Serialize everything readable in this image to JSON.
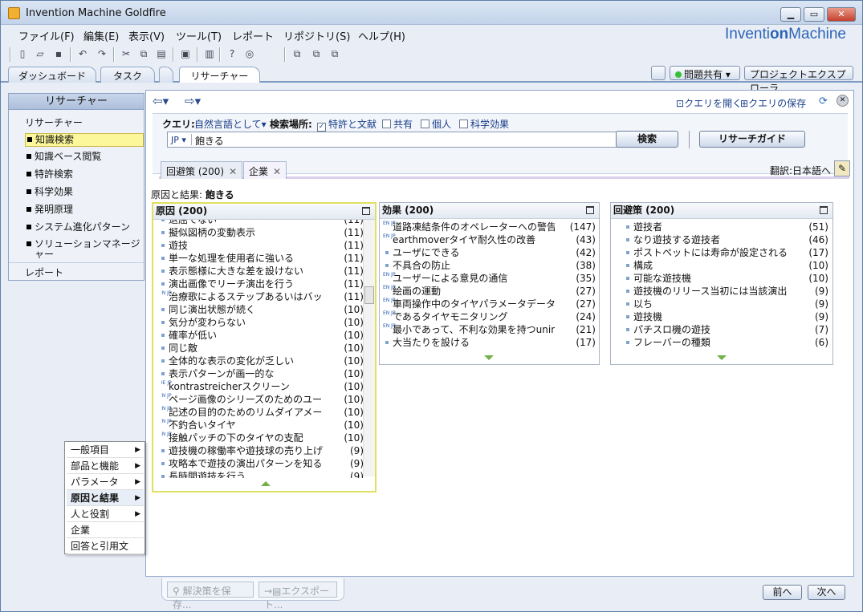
{
  "window": {
    "title": "Invention Machine Goldfire"
  },
  "brand": {
    "part1": "Inventi",
    "part2": "on",
    "part3": "Machine"
  },
  "menu": [
    "ファイル(F)",
    "編集(E)",
    "表示(V)",
    "ツール(T)",
    "レポート",
    "リポジトリ(S)",
    "ヘルプ(H)"
  ],
  "tabs": [
    "ダッシュボード",
    "タスク",
    "リサーチャー"
  ],
  "right_buttons": {
    "issue": "問題共有 ▾",
    "explorer": "プロジェクトエクスプローラ"
  },
  "sidebar": {
    "header": "リサーチャー",
    "section": "リサーチャー",
    "items": [
      "知識検索",
      "知識ベース閲覧",
      "特許検索",
      "科学効果",
      "発明原理",
      "システム進化パターン",
      "ソリューションマネージャー"
    ],
    "footer": "レポート"
  },
  "nav": {
    "open_query": "クエリを開く",
    "save_query": "クエリの保存"
  },
  "query": {
    "label": "クエリ:",
    "mode": "自然言語として",
    "location_label": "検索場所:",
    "opt_patent": "特許と文献",
    "opt_shared": "共有",
    "opt_personal": "個人",
    "opt_science": "科学効果",
    "lang": "JP ▾",
    "value": "飽きる",
    "search_btn": "検索",
    "guide_btn": "リサーチガイド"
  },
  "subtabs": [
    {
      "label": "回避策 (200)"
    },
    {
      "label": "企業"
    }
  ],
  "translate": "翻訳:日本語へ",
  "crumb": {
    "label": "原因と結果:",
    "value": "飽きる"
  },
  "panels": [
    {
      "title": "原因 (200)",
      "rows": [
        {
          "t": "退屈でない",
          "c": "(11)"
        },
        {
          "t": "擬似図柄の変動表示",
          "c": "(11)"
        },
        {
          "t": "遊技",
          "c": "(11)"
        },
        {
          "t": "単一な処理を使用者に強いる",
          "c": "(11)"
        },
        {
          "t": "表示態様に大きな差を設けない",
          "c": "(11)"
        },
        {
          "t": "演出画像でリーチ演出を行う",
          "c": "(11)"
        },
        {
          "t": "治療歌によるステップあるいはバッケ...",
          "c": "(11)",
          "tag": "EN JP"
        },
        {
          "t": "同じ演出状態が続く",
          "c": "(10)"
        },
        {
          "t": "気分が変わらない",
          "c": "(10)"
        },
        {
          "t": "確率が低い",
          "c": "(10)"
        },
        {
          "t": "同じ敵",
          "c": "(10)"
        },
        {
          "t": "全体的な表示の変化が乏しい",
          "c": "(10)"
        },
        {
          "t": "表示パターンが画一的な",
          "c": "(10)"
        },
        {
          "t": "kontrastreicherスクリーン",
          "c": "(10)",
          "tag": "DE JP"
        },
        {
          "t": "ページ画像のシリーズのためのユー...",
          "c": "(10)",
          "tag": "EN JP"
        },
        {
          "t": "記述の目的のためのリムダイアメータ...",
          "c": "(10)",
          "tag": "EN JP"
        },
        {
          "t": "不釣合いタイヤ",
          "c": "(10)",
          "tag": "EN JP"
        },
        {
          "t": "接触パッチの下のタイヤの支配",
          "c": "(10)",
          "tag": "EN JP"
        },
        {
          "t": "遊技機の稼働率や遊技球の売り上げ...",
          "c": "(9)"
        },
        {
          "t": "攻略本で遊技の演出パターンを知る",
          "c": "(9)"
        },
        {
          "t": "長時間遊技を行う",
          "c": "(9)"
        }
      ]
    },
    {
      "title": "効果 (200)",
      "rows": [
        {
          "t": "道路凍結条件のオペレーターへの警告",
          "c": "(147)",
          "tag": "EN JP"
        },
        {
          "t": "earthmoverタイヤ耐久性の改善",
          "c": "(43)",
          "tag": "EN JP"
        },
        {
          "t": "ユーザにできる",
          "c": "(42)"
        },
        {
          "t": "不具合の防止",
          "c": "(38)"
        },
        {
          "t": "ユーザーによる意見の通信",
          "c": "(35)",
          "tag": "EN JP"
        },
        {
          "t": "絵画の運動",
          "c": "(27)",
          "tag": "EN JP"
        },
        {
          "t": "車両操作中のタイヤパラメータデータ",
          "c": "(27)",
          "tag": "EN JP"
        },
        {
          "t": "であるタイヤモニタリング",
          "c": "(24)",
          "tag": "EN JP"
        },
        {
          "t": "最小であって、不利な効果を持つuninflate...",
          "c": "(21)",
          "tag": "EN JP"
        },
        {
          "t": "大当たりを設ける",
          "c": "(17)"
        }
      ]
    },
    {
      "title": "回避策 (200)",
      "rows": [
        {
          "t": "遊技者",
          "c": "(51)"
        },
        {
          "t": "なり遊技する遊技者",
          "c": "(46)"
        },
        {
          "t": "ポストペットには寿命が設定される",
          "c": "(17)"
        },
        {
          "t": "構成",
          "c": "(10)"
        },
        {
          "t": "可能な遊技機",
          "c": "(10)"
        },
        {
          "t": "遊技機のリリース当初には当該演出を表...",
          "c": "(9)"
        },
        {
          "t": "以ち",
          "c": "(9)"
        },
        {
          "t": "遊技機",
          "c": "(9)"
        },
        {
          "t": "パチスロ機の遊技",
          "c": "(7)"
        },
        {
          "t": "フレーバーの種類",
          "c": "(6)"
        }
      ]
    }
  ],
  "context_menu": [
    {
      "label": "一般項目",
      "arrow": "▶"
    },
    {
      "label": "部品と機能",
      "arrow": "▶"
    },
    {
      "label": "パラメータ",
      "arrow": "▶"
    },
    {
      "label": "原因と結果",
      "arrow": "▶"
    },
    {
      "label": "人と役割",
      "arrow": "▶"
    },
    {
      "label": "企業",
      "arrow": ""
    },
    {
      "label": "回答と引用文",
      "arrow": ""
    }
  ],
  "bottom": {
    "save": "解決策を保存...",
    "export": "エクスポート..."
  },
  "paging": {
    "prev": "前へ",
    "next": "次へ"
  }
}
